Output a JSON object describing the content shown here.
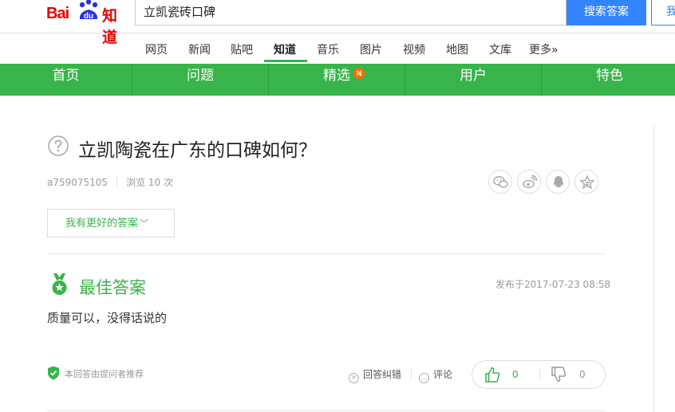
{
  "search": {
    "brand_bai": "Bai",
    "brand_du": "du",
    "brand_product": "知道",
    "query": "立凯瓷砖口碑",
    "submit_label": "搜索答案",
    "ask_label": "我要提问"
  },
  "product_tabs": [
    {
      "label": "网页"
    },
    {
      "label": "新闻"
    },
    {
      "label": "贴吧"
    },
    {
      "label": "知道",
      "active": true
    },
    {
      "label": "音乐"
    },
    {
      "label": "图片"
    },
    {
      "label": "视频"
    },
    {
      "label": "地图"
    },
    {
      "label": "文库"
    },
    {
      "label": "更多»"
    }
  ],
  "green_nav": {
    "items": [
      {
        "label": "首页"
      },
      {
        "label": "问题"
      },
      {
        "label": "精选",
        "badge": "N"
      },
      {
        "label": "用户"
      },
      {
        "label": "特色"
      }
    ]
  },
  "question": {
    "title": "立凯陶瓷在广东的口碑如何？",
    "asker": "a759075105",
    "views": "浏览 10 次",
    "share_icons": [
      "wechat-icon",
      "weibo-icon",
      "qq-icon",
      "qzone-icon"
    ],
    "better_answer_label": "我有更好的答案"
  },
  "best_answer": {
    "heading": "最佳答案",
    "published": "发布于2017-07-23 08:58",
    "text": "质量可以，没得话说的",
    "recommended_note": "本回答由提问者推荐",
    "report_label": "回答纠错",
    "comment_label": "评论",
    "upvotes": "0",
    "downvotes": "0"
  },
  "colors": {
    "brand_red": "#e10602",
    "accent_green": "#38b44a",
    "search_blue": "#3385ff",
    "badge_orange": "#ff6a00"
  }
}
